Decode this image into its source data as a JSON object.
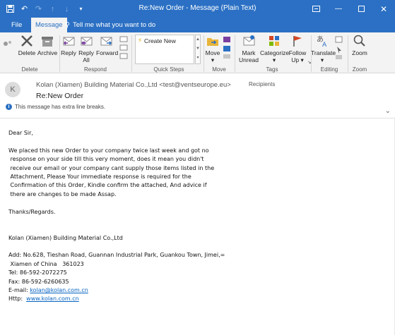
{
  "window": {
    "title": "Re:New Order  -  Message (Plain Text)"
  },
  "tabs": [
    {
      "label": "File"
    },
    {
      "label": "Message"
    }
  ],
  "tell_me": "Tell me what you want to do",
  "ribbon": {
    "delete_group": {
      "delete": "Delete",
      "archive": "Archive",
      "label": "Delete"
    },
    "respond_group": {
      "reply": "Reply",
      "reply_all_1": "Reply",
      "reply_all_2": "All",
      "forward": "Forward",
      "label": "Respond"
    },
    "quick_steps": {
      "create_new": "Create New",
      "label": "Quick Steps"
    },
    "move_group": {
      "move": "Move",
      "label": "Move"
    },
    "tags_group": {
      "mark_unread_1": "Mark",
      "mark_unread_2": "Unread",
      "categorize": "Categorize",
      "follow_up_1": "Follow",
      "follow_up_2": "Up",
      "label": "Tags"
    },
    "editing_group": {
      "translate": "Translate",
      "label": "Editing"
    },
    "zoom_group": {
      "zoom": "Zoom",
      "label": "Zoom"
    }
  },
  "header": {
    "avatar_letter": "K",
    "sender": "Kolan (Xiamen) Building Material Co.,Ltd <test@ventseurope.eu>",
    "recipients": "Recipients",
    "subject": "Re:New Order",
    "info": "This message has extra line breaks."
  },
  "body": {
    "greeting": "Dear Sir,",
    "para": [
      "We placed this new Order to your company twice last week and got no",
      " response on your side till this very moment, does it mean you didn't",
      " receive our email or your company cant supply those items listed in the",
      " Attachment, Please Your immediate response is required for the",
      " Confirmation of this Order, Kindle confirm the attached, And advice if",
      " there are changes to be made Assap."
    ],
    "thanks": "Thanks/Regards.",
    "company": "Kolan (Xiamen) Building Material Co.,Ltd",
    "address_1": "Add: No.628, Tieshan Road, Guannan Industrial Park, Guankou Town, Jimei,=",
    "address_2": " Xiamen of China   361023",
    "tel": "Tel: 86-592-2072275",
    "fax": "Fax: 86-592-6260635",
    "email_label": "E-mail: ",
    "email": "kolan@kolan.com.cn",
    "http_label": "Http:  ",
    "website": "www.kolan.com.cn"
  },
  "colors": {
    "accent": "#2b70c4",
    "link": "#0563c1"
  }
}
